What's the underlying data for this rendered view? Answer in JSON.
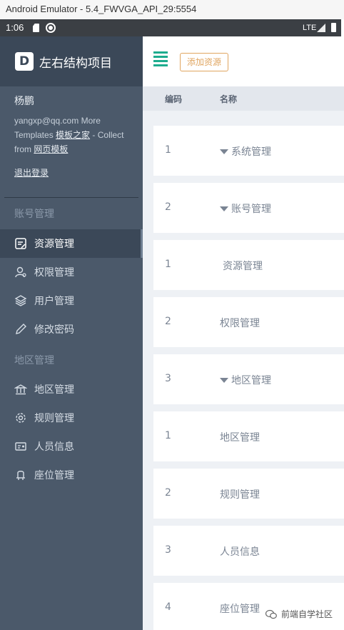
{
  "window": {
    "title": "Android Emulator - 5.4_FWVGA_API_29:5554"
  },
  "status_bar": {
    "time": "1:06",
    "network": "LTE",
    "icons": [
      "sd-card-icon",
      "sync-icon",
      "signal-icon",
      "battery-icon"
    ]
  },
  "brand": {
    "logo_letter": "D",
    "title": "左右结构项目"
  },
  "user": {
    "name": "杨鹏",
    "email": "yangxp@qq.com",
    "info_more": "More",
    "info_templates": "Templates",
    "link_template_home": "模板之家",
    "info_collect": "- Collect",
    "info_from": "from",
    "link_web_template": "网页模板",
    "logout": "退出登录"
  },
  "sidebar": {
    "group1": "账号管理",
    "group2": "地区管理",
    "items": [
      {
        "label": "资源管理",
        "icon": "resource-icon",
        "active": true
      },
      {
        "label": "权限管理",
        "icon": "permission-icon",
        "active": false
      },
      {
        "label": "用户管理",
        "icon": "layers-icon",
        "active": false
      },
      {
        "label": "修改密码",
        "icon": "pen-icon",
        "active": false
      },
      {
        "label": "地区管理",
        "icon": "bank-icon",
        "active": false
      },
      {
        "label": "规则管理",
        "icon": "gear-icon",
        "active": false
      },
      {
        "label": "人员信息",
        "icon": "id-card-icon",
        "active": false
      },
      {
        "label": "座位管理",
        "icon": "seat-icon",
        "active": false
      }
    ]
  },
  "toolbar": {
    "add_label": "添加资源"
  },
  "table": {
    "columns": [
      "编码",
      "名称"
    ],
    "rows": [
      {
        "code": "1",
        "name": "系统管理",
        "expandable": true
      },
      {
        "code": "2",
        "name": "账号管理",
        "expandable": true
      },
      {
        "code": "1",
        "name": "资源管理",
        "expandable": false
      },
      {
        "code": "2",
        "name": "权限管理",
        "expandable": false
      },
      {
        "code": "3",
        "name": "地区管理",
        "expandable": true
      },
      {
        "code": "1",
        "name": "地区管理",
        "expandable": false
      },
      {
        "code": "2",
        "name": "规则管理",
        "expandable": false
      },
      {
        "code": "3",
        "name": "人员信息",
        "expandable": false
      },
      {
        "code": "4",
        "name": "座位管理",
        "expandable": false
      }
    ]
  },
  "watermark": {
    "text": "前端自学社区"
  },
  "colors": {
    "sidebar": "#4b596a",
    "sidebar_dark": "#3b4858",
    "accent_green": "#1dac8e",
    "accent_orange": "#e0a560"
  }
}
